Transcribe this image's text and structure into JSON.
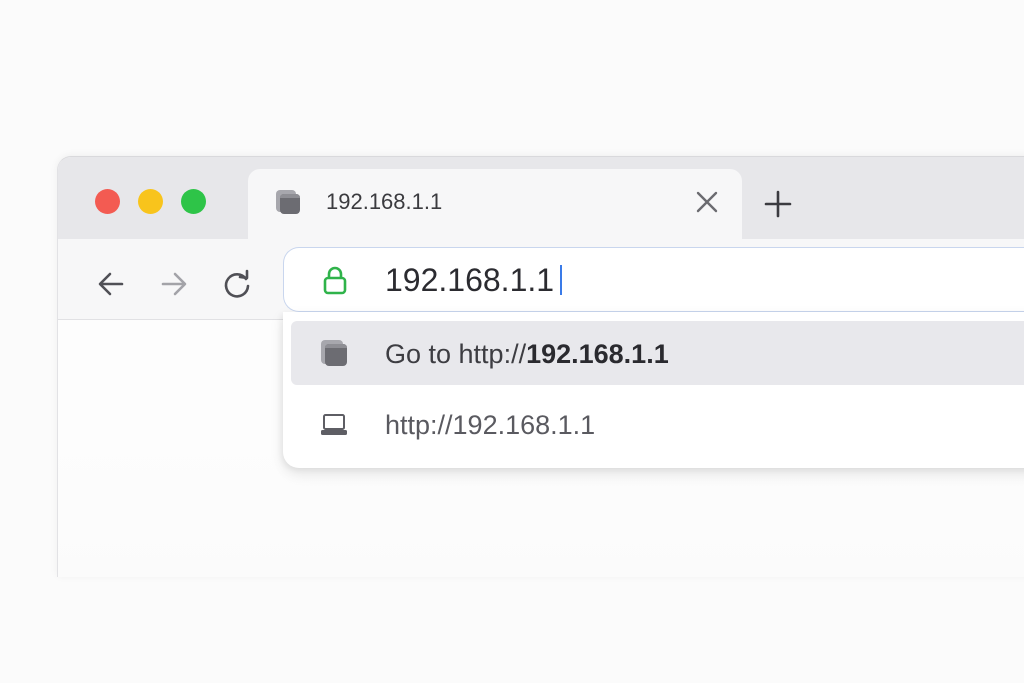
{
  "tab": {
    "title": "192.168.1.1",
    "favicon": "page-icon",
    "close_icon": "close-icon"
  },
  "new_tab_icon": "plus-icon",
  "traffic_lights": [
    {
      "name": "close",
      "color": "#f35b52"
    },
    {
      "name": "minimize",
      "color": "#f8c41c"
    },
    {
      "name": "zoom",
      "color": "#2ec448"
    }
  ],
  "nav": {
    "back_icon": "arrow-left-icon",
    "forward_icon": "arrow-right-icon",
    "reload_icon": "reload-icon"
  },
  "omnibox": {
    "value": "192.168.1.1",
    "lock_icon": "lock-icon",
    "lock_color": "#2fb34a"
  },
  "suggestions": [
    {
      "prefix": "Go to http://",
      "bold": "192.168.1.1",
      "icon": "page-icon",
      "highlighted": true
    },
    {
      "text": "http://192.168.1.1",
      "icon": "laptop-icon",
      "highlighted": false
    }
  ],
  "colors": {
    "caret": "#3a7be8",
    "highlight": "#e8e8ec"
  }
}
